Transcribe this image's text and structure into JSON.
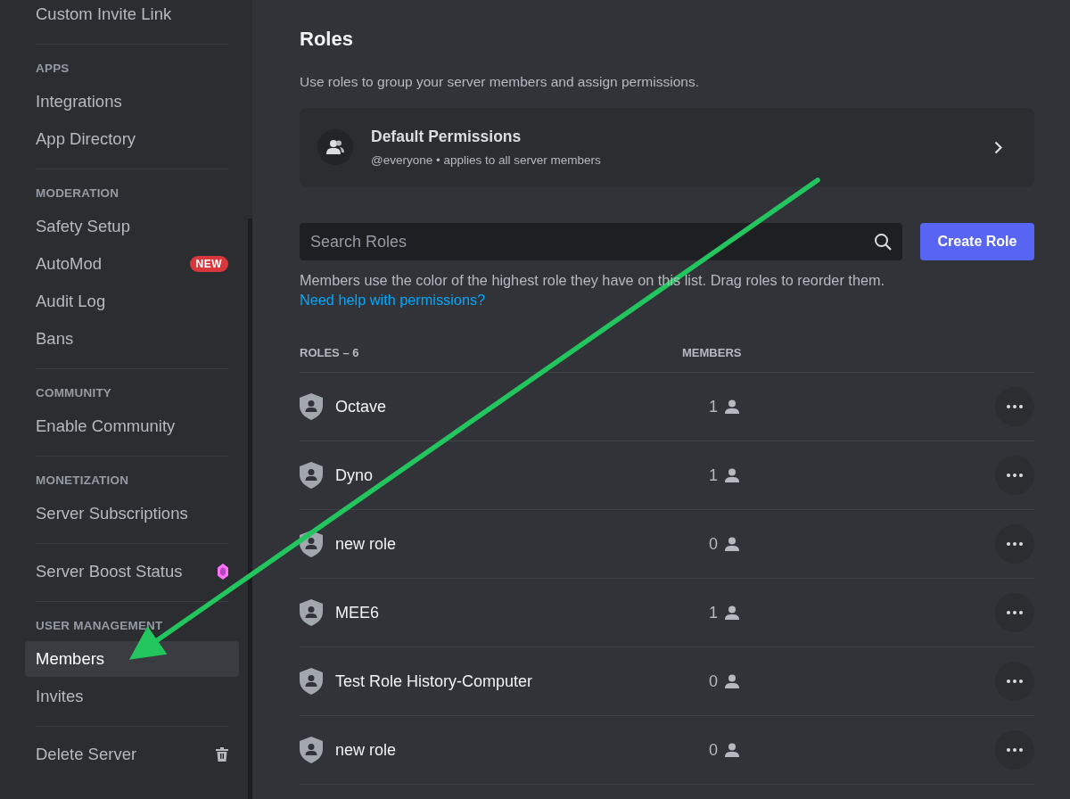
{
  "sidebar": {
    "sections": [
      {
        "items": [
          {
            "label": "Custom Invite Link",
            "selected": false
          }
        ]
      },
      {
        "header": "APPS",
        "items": [
          {
            "label": "Integrations",
            "selected": false
          },
          {
            "label": "App Directory",
            "selected": false
          }
        ]
      },
      {
        "header": "MODERATION",
        "items": [
          {
            "label": "Safety Setup",
            "selected": false
          },
          {
            "label": "AutoMod",
            "selected": false,
            "badge": "NEW"
          },
          {
            "label": "Audit Log",
            "selected": false
          },
          {
            "label": "Bans",
            "selected": false
          }
        ]
      },
      {
        "header": "COMMUNITY",
        "items": [
          {
            "label": "Enable Community",
            "selected": false
          }
        ]
      },
      {
        "header": "MONETIZATION",
        "items": [
          {
            "label": "Server Subscriptions",
            "selected": false
          }
        ]
      },
      {
        "items": [
          {
            "label": "Server Boost Status",
            "selected": false,
            "kind": "gem"
          }
        ]
      },
      {
        "header": "USER MANAGEMENT",
        "items": [
          {
            "label": "Members",
            "selected": true
          },
          {
            "label": "Invites",
            "selected": false
          }
        ]
      },
      {
        "items": [
          {
            "label": "Delete Server",
            "selected": false,
            "kind": "trash"
          }
        ]
      }
    ]
  },
  "main": {
    "title": "Roles",
    "description": "Use roles to group your server members and assign permissions.",
    "default_permissions": {
      "title": "Default Permissions",
      "subtitle": "@everyone • applies to all server members"
    },
    "search": {
      "placeholder": "Search Roles"
    },
    "create_button": "Create Role",
    "help": {
      "text": "Members use the color of the highest role they have on this list. Drag roles to reorder them.",
      "link": "Need help with permissions?"
    },
    "table": {
      "columns": [
        "ROLES – 6",
        "MEMBERS"
      ],
      "rows": [
        {
          "name": "Octave",
          "members": "1"
        },
        {
          "name": "Dyno",
          "members": "1"
        },
        {
          "name": "new role",
          "members": "0"
        },
        {
          "name": "MEE6",
          "members": "1"
        },
        {
          "name": "Test Role History-Computer",
          "members": "0"
        },
        {
          "name": "new role",
          "members": "0"
        }
      ]
    }
  }
}
